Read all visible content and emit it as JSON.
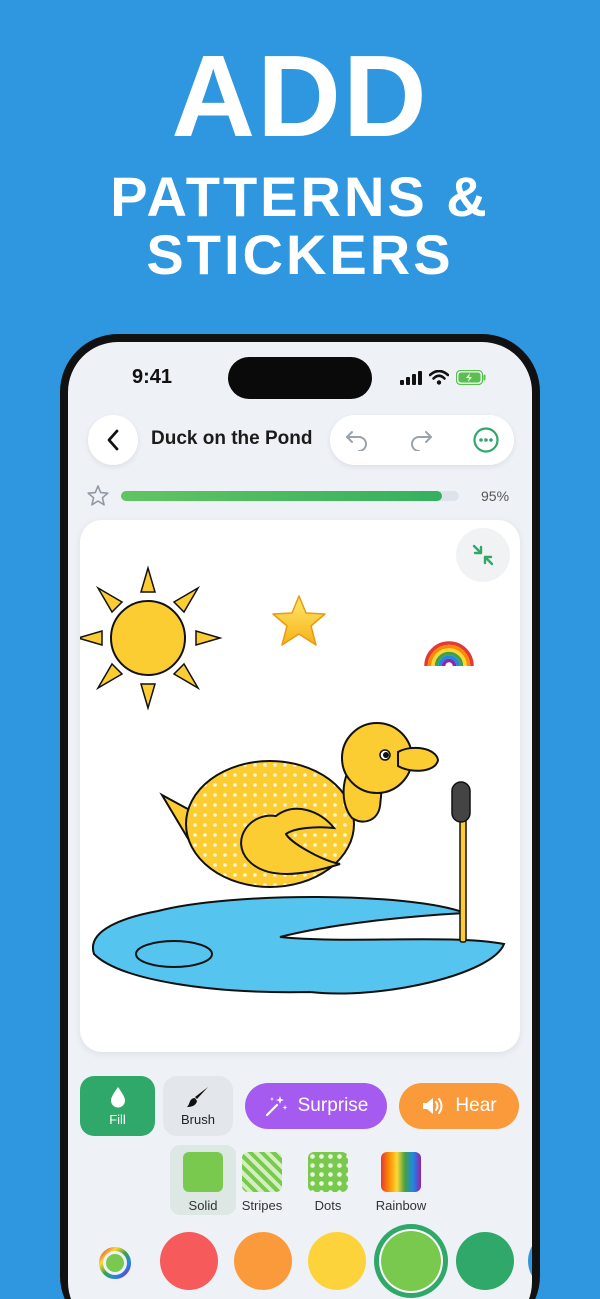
{
  "promo": {
    "headline": "ADD",
    "subline_1": "PATTERNS &",
    "subline_2": "STICKERS"
  },
  "status": {
    "time": "9:41"
  },
  "header": {
    "title": "Duck on the Pond"
  },
  "progress": {
    "value": 0.95,
    "label": "95%"
  },
  "tools": {
    "fill_label": "Fill",
    "brush_label": "Brush",
    "surprise_label": "Surprise",
    "hear_label": "Hear"
  },
  "patterns": [
    {
      "label": "Solid",
      "selected": true
    },
    {
      "label": "Stripes"
    },
    {
      "label": "Dots"
    },
    {
      "label": "Rainbow"
    }
  ],
  "palette": {
    "colors": [
      "#f75a5a",
      "#fb9a3b",
      "#fdd33c",
      "#7ac94f",
      "#2fa86a"
    ],
    "selected": "#7ac94f"
  },
  "icons": [
    "back-arrow-icon",
    "undo-icon",
    "redo-icon",
    "more-icon",
    "star-outline-icon",
    "collapse-icon",
    "droplet-icon",
    "brush-icon",
    "sparkle-wand-icon",
    "speaker-icon",
    "color-wheel-icon",
    "sun-sticker",
    "star-sticker",
    "rainbow-sticker"
  ]
}
